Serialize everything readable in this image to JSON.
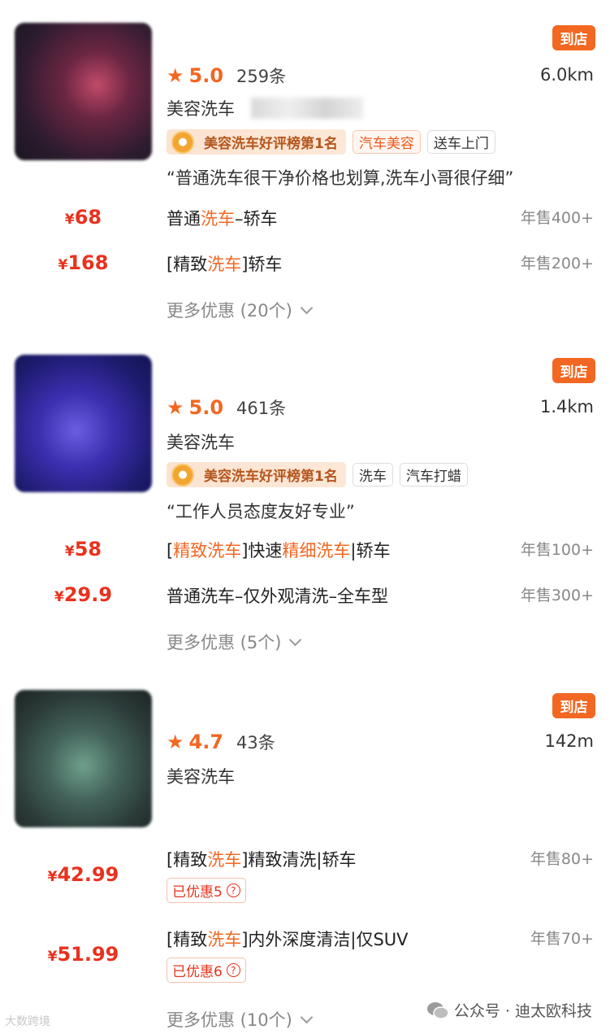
{
  "shops": [
    {
      "store_badge": "到店",
      "score": "5.0",
      "reviews": "259条",
      "distance": "6.0km",
      "category": "美容洗车",
      "rank_tag": "美容洗车好评榜第1名",
      "tags": [
        {
          "label": "汽车美容",
          "style": "orange"
        },
        {
          "label": "送车上门",
          "style": "plain"
        }
      ],
      "quote": "“普通洗车很干净价格也划算,洗车小哥很仔细”",
      "deals": [
        {
          "price": "68",
          "title_parts": [
            {
              "t": "普通",
              "hl": false
            },
            {
              "t": "洗车",
              "hl": true
            },
            {
              "t": "–轿车",
              "hl": false
            }
          ],
          "sold": "年售400+"
        },
        {
          "price": "168",
          "title_parts": [
            {
              "t": "[精致",
              "hl": false
            },
            {
              "t": "洗车",
              "hl": true
            },
            {
              "t": "]轿车",
              "hl": false
            }
          ],
          "sold": "年售200+"
        }
      ],
      "more": "更多优惠 (20个)"
    },
    {
      "store_badge": "到店",
      "score": "5.0",
      "reviews": "461条",
      "distance": "1.4km",
      "category": "美容洗车",
      "rank_tag": "美容洗车好评榜第1名",
      "tags": [
        {
          "label": "洗车",
          "style": "plain"
        },
        {
          "label": "汽车打蜡",
          "style": "plain"
        }
      ],
      "quote": "“工作人员态度友好专业”",
      "deals": [
        {
          "price": "58",
          "title_parts": [
            {
              "t": "[",
              "hl": false
            },
            {
              "t": "精致洗车",
              "hl": true
            },
            {
              "t": "]快速",
              "hl": false
            },
            {
              "t": "精细洗车",
              "hl": true
            },
            {
              "t": "|轿车",
              "hl": false
            }
          ],
          "sold": "年售100+"
        },
        {
          "price": "29.9",
          "title_parts": [
            {
              "t": "普通洗车–仅外观清洗–全车型",
              "hl": false
            }
          ],
          "sold": "年售300+"
        }
      ],
      "more": "更多优惠 (5个)"
    },
    {
      "store_badge": "到店",
      "score": "4.7",
      "reviews": "43条",
      "distance": "142m",
      "category": "美容洗车",
      "deals": [
        {
          "price": "42.99",
          "title_parts": [
            {
              "t": "[精致",
              "hl": false
            },
            {
              "t": "洗车",
              "hl": true
            },
            {
              "t": "]精致清洗|轿车",
              "hl": false
            }
          ],
          "sold": "年售80+",
          "coupon": "已优惠5"
        },
        {
          "price": "51.99",
          "title_parts": [
            {
              "t": "[精致",
              "hl": false
            },
            {
              "t": "洗车",
              "hl": true
            },
            {
              "t": "]内外深度清洁|仅SUV",
              "hl": false
            }
          ],
          "sold": "年售70+",
          "coupon": "已优惠6"
        }
      ],
      "more": "更多优惠 (10个)"
    }
  ],
  "currency": "¥",
  "coupon_help_icon": "?",
  "watermark": "公众号 · 迪太欧科技",
  "corner_logo": "大数跨境",
  "colors": {
    "accent": "#f26722",
    "price": "#e8321e",
    "muted": "#888888"
  }
}
